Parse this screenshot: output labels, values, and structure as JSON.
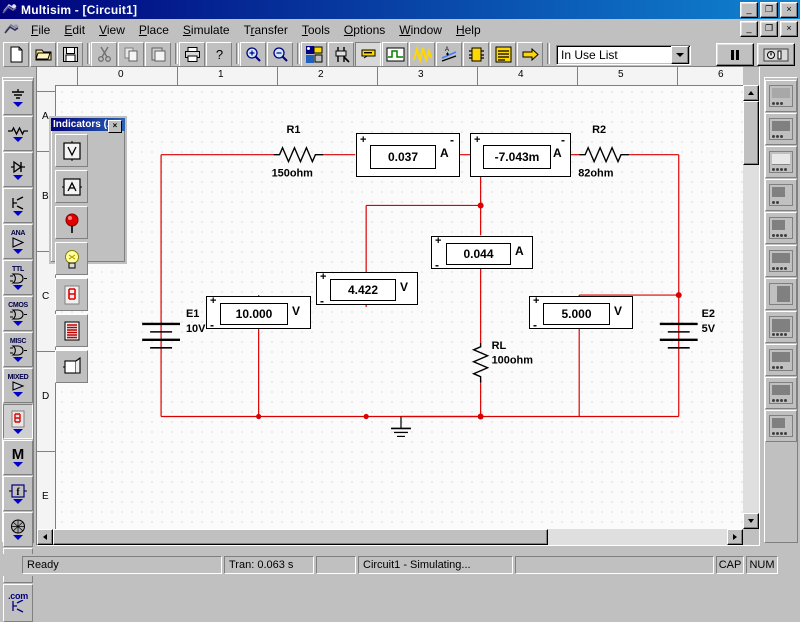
{
  "window": {
    "title": "Multisim - [Circuit1]",
    "app_icon": "multisim-icon",
    "buttons_outer": [
      {
        "name": "minimize",
        "glyph": "_"
      },
      {
        "name": "restore",
        "glyph": "❐"
      },
      {
        "name": "close",
        "glyph": "×"
      }
    ],
    "buttons_inner": [
      {
        "name": "minimize",
        "glyph": "_"
      },
      {
        "name": "restore",
        "glyph": "❐"
      },
      {
        "name": "close",
        "glyph": "×"
      }
    ]
  },
  "menu": {
    "doc_icon": "document-icon",
    "items": [
      {
        "label": "File",
        "key": "F"
      },
      {
        "label": "Edit",
        "key": "E"
      },
      {
        "label": "View",
        "key": "V"
      },
      {
        "label": "Place",
        "key": "P"
      },
      {
        "label": "Simulate",
        "key": "S"
      },
      {
        "label": "Transfer",
        "key": "r"
      },
      {
        "label": "Tools",
        "key": "T"
      },
      {
        "label": "Options",
        "key": "O"
      },
      {
        "label": "Window",
        "key": "W"
      },
      {
        "label": "Help",
        "key": "H"
      }
    ]
  },
  "toolbar": {
    "buttons": [
      {
        "name": "new-button",
        "icon": "new-document-icon"
      },
      {
        "name": "open-button",
        "icon": "open-folder-icon"
      },
      {
        "name": "save-button",
        "icon": "floppy-disk-icon"
      },
      {
        "name": "cut-button",
        "icon": "scissors-icon"
      },
      {
        "name": "copy-button",
        "icon": "copy-icon"
      },
      {
        "name": "paste-button",
        "icon": "clipboard-icon"
      },
      {
        "name": "print-button",
        "icon": "printer-icon"
      },
      {
        "name": "help-button",
        "icon": "question-mark-icon"
      },
      {
        "name": "zoom-in-button",
        "icon": "magnifier-plus-icon"
      },
      {
        "name": "zoom-out-button",
        "icon": "magnifier-minus-icon"
      },
      {
        "name": "database-button",
        "icon": "component-database-icon"
      },
      {
        "name": "edit-component-button",
        "icon": "component-editor-icon"
      },
      {
        "name": "labels-button",
        "icon": "label-tag-icon"
      },
      {
        "name": "analysis-dc-button",
        "icon": "dc-operating-point-icon"
      },
      {
        "name": "postprocessor-button",
        "icon": "waveform-icon"
      },
      {
        "name": "analysis-graph-button",
        "icon": "analysis-graph-icon"
      },
      {
        "name": "chip-button",
        "icon": "ic-chip-icon"
      },
      {
        "name": "report-button",
        "icon": "netlist-report-icon"
      },
      {
        "name": "transfer-button",
        "icon": "yellow-arrow-icon"
      }
    ],
    "combo": {
      "name": "in-use-list",
      "value": "In Use List",
      "options": [
        "In Use List"
      ]
    },
    "run_buttons": [
      {
        "name": "pause-button",
        "icon": "pause-icon"
      },
      {
        "name": "simulation-switch-button",
        "icon": "power-switch-icon"
      }
    ]
  },
  "left_toolbar": {
    "items": [
      {
        "name": "sources-bar",
        "label": "",
        "icon": "ground-source-icon"
      },
      {
        "name": "basic-bar",
        "label": "",
        "icon": "resistor-icon"
      },
      {
        "name": "diodes-bar",
        "label": "",
        "icon": "diode-icon"
      },
      {
        "name": "transistors-bar",
        "label": "",
        "icon": "transistor-icon"
      },
      {
        "name": "analog-bar",
        "label": "ANA",
        "icon": "opamp-icon"
      },
      {
        "name": "ttl-bar",
        "label": "TTL",
        "icon": "logic-gate-icon"
      },
      {
        "name": "cmos-bar",
        "label": "CMOS",
        "icon": "logic-gate-icon"
      },
      {
        "name": "misc-digital-bar",
        "label": "MISC",
        "icon": "logic-gate-icon"
      },
      {
        "name": "mixed-bar",
        "label": "MIXED",
        "icon": "mixed-icon"
      },
      {
        "name": "indicators-bar",
        "label": "",
        "icon": "seven-segment-icon",
        "selected": true
      },
      {
        "name": "miscellaneous-bar",
        "label": "M",
        "icon": "letter-m-icon"
      },
      {
        "name": "controls-bar",
        "label": "",
        "icon": "transfer-function-icon"
      },
      {
        "name": "rf-bar",
        "label": "",
        "icon": "rf-globe-icon"
      },
      {
        "name": "electromechanical-bar",
        "label": "",
        "icon": "motor-icon"
      },
      {
        "name": "edaparts-com-bar",
        "label": ".com",
        "icon": "edaparts-icon"
      }
    ]
  },
  "right_toolbar": {
    "items": [
      {
        "name": "multimeter-button",
        "icon": "multimeter-icon"
      },
      {
        "name": "function-generator-button",
        "icon": "function-generator-icon"
      },
      {
        "name": "wattmeter-button",
        "icon": "wattmeter-icon"
      },
      {
        "name": "oscilloscope-button",
        "icon": "oscilloscope-icon"
      },
      {
        "name": "bode-plotter-button",
        "icon": "bode-plotter-icon"
      },
      {
        "name": "word-generator-button",
        "icon": "word-generator-icon"
      },
      {
        "name": "logic-analyzer-button",
        "icon": "logic-analyzer-icon"
      },
      {
        "name": "logic-converter-button",
        "icon": "logic-converter-icon"
      },
      {
        "name": "distortion-analyzer-button",
        "icon": "distortion-analyzer-icon"
      },
      {
        "name": "spectrum-analyzer-button",
        "icon": "spectrum-analyzer-icon"
      },
      {
        "name": "network-analyzer-button",
        "icon": "network-analyzer-icon"
      }
    ]
  },
  "palette": {
    "title": "Indicators (...",
    "close_glyph": "×",
    "buttons": [
      {
        "name": "voltmeter-button",
        "icon": "voltmeter-icon",
        "glyph": "V"
      },
      {
        "name": "ammeter-button",
        "icon": "ammeter-icon",
        "glyph": "A"
      },
      {
        "name": "probe-button",
        "icon": "red-probe-icon"
      },
      {
        "name": "lamp-button",
        "icon": "lamp-icon"
      },
      {
        "name": "seven-segment-button",
        "icon": "seven-segment-display-icon"
      },
      {
        "name": "bargraph-button",
        "icon": "bargraph-display-icon"
      },
      {
        "name": "buzzer-button",
        "icon": "buzzer-icon"
      }
    ]
  },
  "rulers": {
    "horizontal": [
      "0",
      "1",
      "2",
      "3",
      "4",
      "5",
      "6"
    ],
    "vertical": [
      "A",
      "B",
      "C",
      "D",
      "E"
    ]
  },
  "schematic": {
    "wire_color": "#dd0000",
    "components": [
      {
        "name": "resistor-r1",
        "ref": "R1",
        "value": "150ohm"
      },
      {
        "name": "resistor-r2",
        "ref": "R2",
        "value": "82ohm"
      },
      {
        "name": "resistor-rl",
        "ref": "RL",
        "value": "100ohm"
      },
      {
        "name": "source-e1",
        "ref": "E1",
        "value": "10V"
      },
      {
        "name": "source-e2",
        "ref": "E2",
        "value": "5V"
      },
      {
        "name": "ground-symbol",
        "ref": "",
        "value": ""
      }
    ],
    "meters": [
      {
        "name": "ammeter-a1",
        "reading": "0.037",
        "unit": "A",
        "plus": "+",
        "minus": "-"
      },
      {
        "name": "ammeter-a2",
        "reading": "-7.043m",
        "unit": "A",
        "plus": "+",
        "minus": "-"
      },
      {
        "name": "ammeter-a3",
        "reading": "0.044",
        "unit": "A",
        "plus": "+",
        "minus": "-"
      },
      {
        "name": "voltmeter-v1",
        "reading": "10.000",
        "unit": "V",
        "plus": "+",
        "minus": "-"
      },
      {
        "name": "voltmeter-v2",
        "reading": "4.422",
        "unit": "V",
        "plus": "+",
        "minus": "-"
      },
      {
        "name": "voltmeter-v3",
        "reading": "5.000",
        "unit": "V",
        "plus": "+",
        "minus": "-"
      }
    ]
  },
  "statusbar": {
    "ready": "Ready",
    "tran": "Tran: 0.063 s",
    "blank": "",
    "doc": "Circuit1 - Simulating...",
    "spacer": "",
    "cap": "CAP",
    "num": "NUM"
  }
}
